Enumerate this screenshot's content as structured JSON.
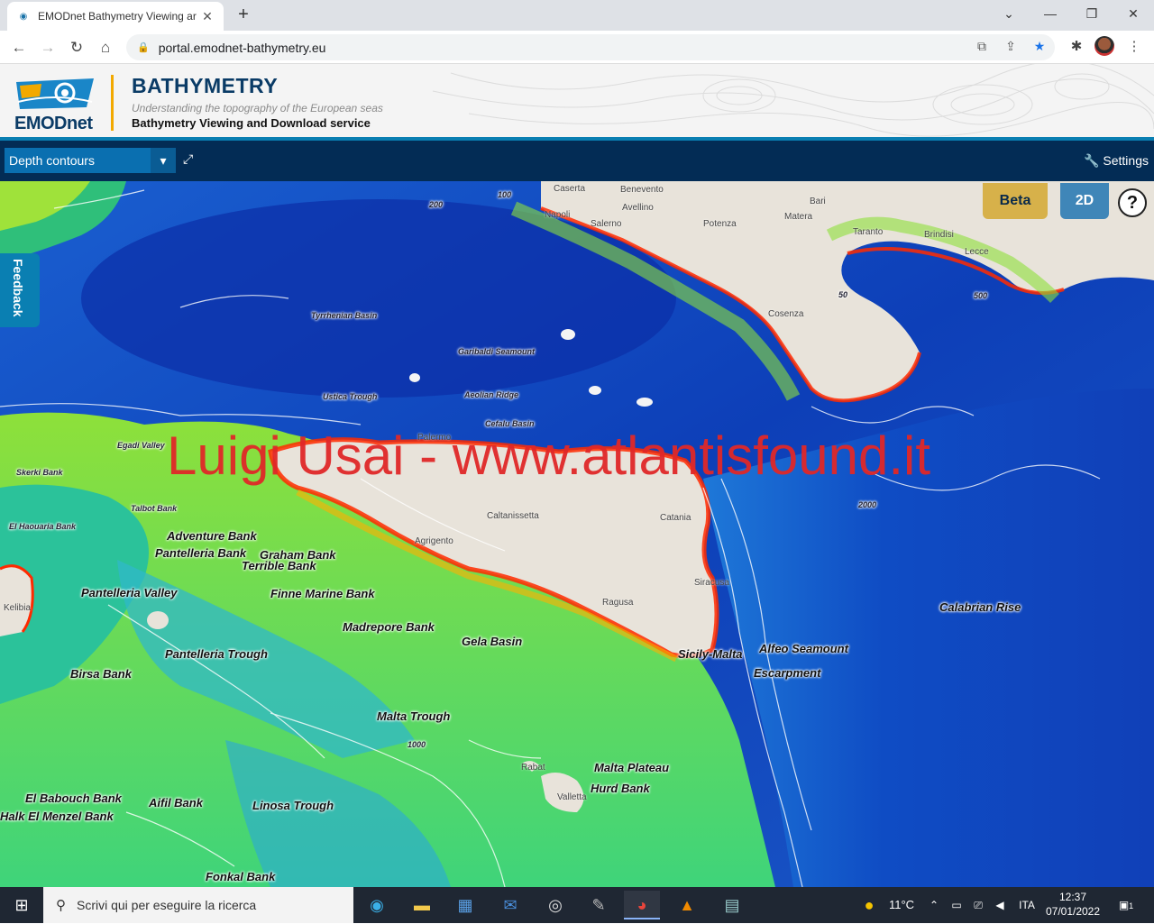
{
  "browser": {
    "tab_title": "EMODnet Bathymetry Viewing ar",
    "url": "portal.emodnet-bathymetry.eu"
  },
  "header": {
    "logo_text": "EMODnet",
    "brand": "BATHYMETRY",
    "tagline": "Understanding the topography of the European seas",
    "service": "Bathymetry Viewing and Download service"
  },
  "toolbar": {
    "layer_selected": "Depth contours",
    "settings_label": "Settings"
  },
  "map": {
    "feedback_label": "Feedback",
    "beta_label": "Beta",
    "mode_label": "2D",
    "help_label": "?",
    "watermark": "Luigi Usai - www.atlantisfound.it",
    "labels": [
      "Adventure Bank",
      "Pantelleria Bank",
      "Graham Bank",
      "Terrible Bank",
      "Pantelleria Valley",
      "Finne Marine Bank",
      "Madrepore Bank",
      "Gela Basin",
      "Pantelleria Trough",
      "Birsa Bank",
      "Malta Trough",
      "Malta Plateau",
      "Hurd Bank",
      "El Babouch Bank",
      "Aifil Bank",
      "Halk El Menzel Bank",
      "Linosa Trough",
      "Fonkal Bank",
      "Sicily-Malta",
      "Escarpment",
      "Alfeo Seamount",
      "Calabrian Rise",
      "El Haouaria Bank",
      "Talbot Bank",
      "Egadi Valley",
      "Skerki Bank",
      "Cefalu Basin",
      "Garibaldi Seamount",
      "Tyrrhenian Basin",
      "Ustica Trough",
      "Aeolian Ridge"
    ],
    "cities": [
      "Caserta",
      "Benevento",
      "Napoli",
      "Salerno",
      "Avellino",
      "Bari",
      "Potenza",
      "Matera",
      "Taranto",
      "Brindisi",
      "Lecce",
      "Cosenza",
      "Agrigento",
      "Caltanissetta",
      "Catania",
      "Siracusa",
      "Ragusa",
      "Rabat",
      "Valletta",
      "Kelibia",
      "Palermo"
    ],
    "contour_labels": [
      "100",
      "200",
      "500",
      "1000",
      "2000",
      "50"
    ]
  },
  "taskbar": {
    "search_placeholder": "Scrivi qui per eseguire la ricerca",
    "weather": "11°C",
    "language": "ITA",
    "time": "12:37",
    "date": "07/01/2022",
    "notifications": "1"
  }
}
